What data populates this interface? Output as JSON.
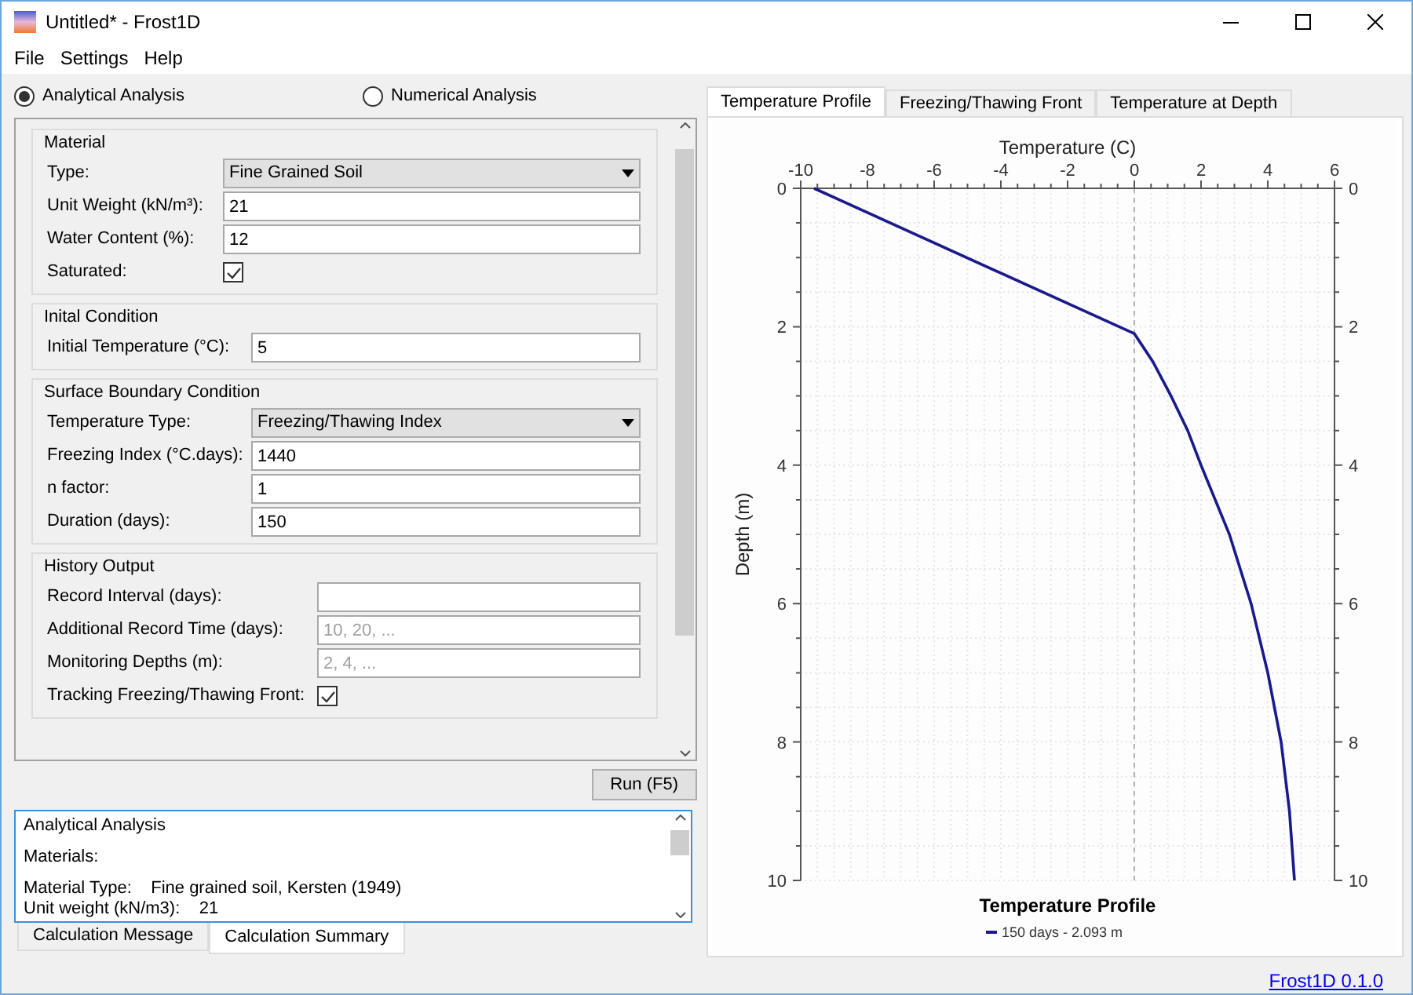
{
  "window": {
    "title": "Untitled* - Frost1D"
  },
  "menu": [
    "File",
    "Settings",
    "Help"
  ],
  "analysis_options": [
    {
      "label": "Analytical Analysis",
      "selected": true
    },
    {
      "label": "Numerical Analysis",
      "selected": false
    }
  ],
  "groups": [
    {
      "title": "Material",
      "fields": [
        {
          "kind": "dropdown",
          "label": "Type:",
          "value": "Fine Grained Soil"
        },
        {
          "kind": "text",
          "label": "Unit Weight (kN/m³):",
          "value": "21"
        },
        {
          "kind": "text",
          "label": "Water Content (%):",
          "value": "12"
        },
        {
          "kind": "checkbox",
          "label": "Saturated:",
          "checked": true
        }
      ]
    },
    {
      "title": "Inital Condition",
      "fields": [
        {
          "kind": "text",
          "label": "Initial Temperature (°C):",
          "value": "5"
        }
      ]
    },
    {
      "title": "Surface Boundary Condition",
      "fields": [
        {
          "kind": "dropdown",
          "label": "Temperature Type:",
          "value": "Freezing/Thawing Index"
        },
        {
          "kind": "text",
          "label": "Freezing Index (°C.days):",
          "value": "1440"
        },
        {
          "kind": "text",
          "label": "n factor:",
          "value": "1"
        },
        {
          "kind": "text",
          "label": "Duration (days):",
          "value": "150"
        }
      ]
    },
    {
      "title": "History Output",
      "fields": [
        {
          "kind": "text",
          "label": "Record Interval (days):"
        },
        {
          "kind": "text",
          "label": "Additional Record Time (days):",
          "placeholder": "10, 20, ..."
        },
        {
          "kind": "text",
          "label": "Monitoring Depths (m):",
          "placeholder": "2, 4, ..."
        },
        {
          "kind": "checkbox",
          "label": "Tracking Freezing/Thawing Front:",
          "checked": true
        }
      ]
    }
  ],
  "run_button": "Run (F5)",
  "summary": {
    "paragraphs": [
      [
        "Analytical Analysis"
      ],
      [
        "Materials:"
      ],
      [
        "Material Type:    Fine grained soil, Kersten (1949)",
        "Unit weight (kN/m3):    21"
      ]
    ]
  },
  "bottom_tabs": [
    {
      "label": "Calculation Message",
      "selected": false
    },
    {
      "label": "Calculation Summary",
      "selected": true
    }
  ],
  "chart_tabs": [
    {
      "label": "Temperature Profile",
      "selected": true
    },
    {
      "label": "Freezing/Thawing Front",
      "selected": false
    },
    {
      "label": "Temperature at Depth",
      "selected": false
    }
  ],
  "chart_data": {
    "type": "line",
    "title": "Temperature Profile",
    "xlabel": "Temperature (C)",
    "ylabel": "Depth (m)",
    "x": [
      -9.6,
      0,
      0.55,
      1.1,
      1.6,
      2.0,
      2.85,
      3.5,
      4.0,
      4.4,
      4.65,
      4.8
    ],
    "series": [
      {
        "name": "150 days - 2.093 m",
        "color": "#1a1a8c",
        "values": [
          0,
          2.1,
          2.5,
          3,
          3.5,
          4,
          5,
          6,
          7,
          8,
          9,
          10
        ]
      }
    ],
    "xlim": [
      -10,
      6
    ],
    "ylim": [
      10,
      0
    ],
    "xticks": [
      -10,
      -8,
      -6,
      -4,
      -2,
      0,
      2,
      4,
      6
    ],
    "yticks": [
      0,
      2,
      4,
      6,
      8,
      10
    ],
    "grid": true,
    "ref_lines": [
      {
        "axis": "x",
        "value": 0
      }
    ]
  },
  "chart_right_axis": {
    "labels": [
      "0",
      "2",
      "4",
      "6",
      "8",
      "10"
    ]
  },
  "status_bar": {
    "link": "Frost1D 0.1.0"
  }
}
